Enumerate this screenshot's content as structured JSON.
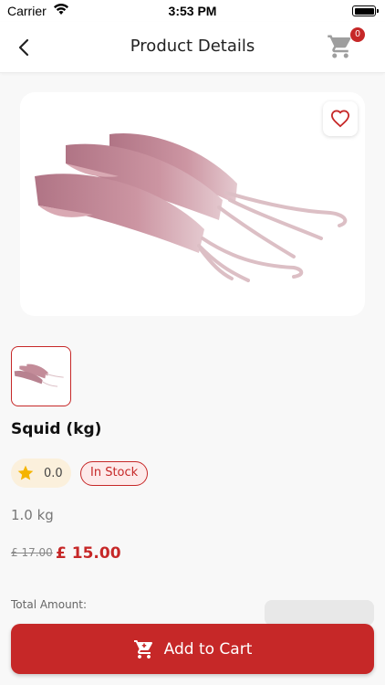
{
  "status_bar": {
    "carrier": "Carrier",
    "time": "3:53 PM",
    "icons": [
      "wifi-icon",
      "battery-icon"
    ]
  },
  "nav": {
    "title": "Product Details",
    "back_icon": "chevron-left-icon",
    "cart_icon": "cart-icon",
    "cart_count": "0"
  },
  "product": {
    "image_desc": "squid",
    "favorite_icon": "heart-outline-icon",
    "name": "Squid (kg)",
    "rating": "0.0",
    "stock_status": "In Stock",
    "weight": "1.0 kg",
    "old_price": "£ 17.00",
    "price": "£ 15.00"
  },
  "footer": {
    "total_label": "Total Amount:",
    "add_to_cart_label": "Add to Cart"
  },
  "colors": {
    "accent": "#c62828",
    "star": "#f5b400",
    "rating_bg": "#fbf0dc",
    "badge_bg": "#fdeaea",
    "background": "#f8f8f8"
  }
}
